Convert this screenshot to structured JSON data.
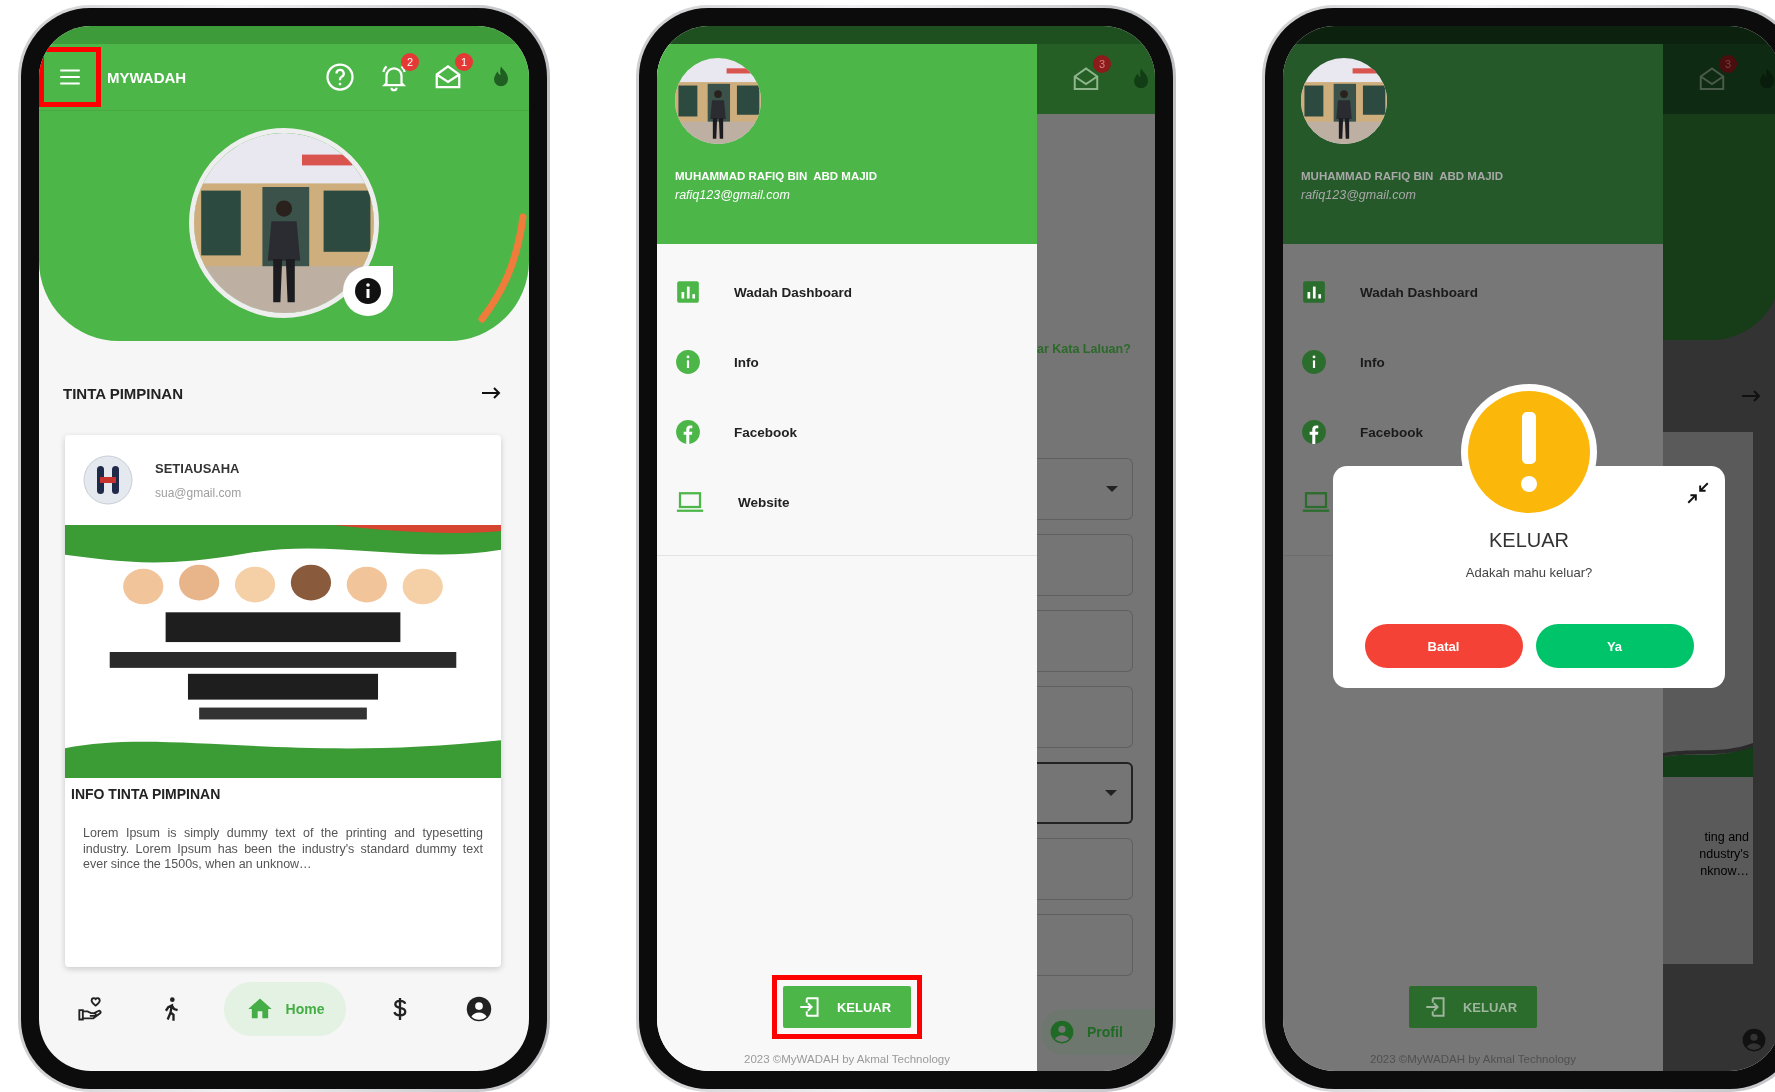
{
  "home_screen": {
    "app_bar": {
      "menu_highlighted": true,
      "title": "MYWADAH",
      "actions": [
        {
          "kind": "help"
        },
        {
          "kind": "notifications",
          "badge": "2"
        },
        {
          "kind": "mail",
          "badge": "1"
        },
        {
          "kind": "logo"
        }
      ]
    },
    "section_title": "TINTA PIMPINAN",
    "post": {
      "author": "SETIAUSAHA",
      "email": "sua@gmail.com",
      "heading": "INFO TINTA PIMPINAN",
      "body": "Lorem Ipsum is simply dummy text of the printing and typesetting industry. Lorem Ipsum has been the industry's standard dummy text ever since the 1500s, when an unknow…"
    },
    "bottom_nav": [
      {
        "kind": "charity",
        "selected": false
      },
      {
        "kind": "activity",
        "selected": false
      },
      {
        "kind": "home",
        "label": "Home",
        "selected": true
      },
      {
        "kind": "payment",
        "selected": false
      },
      {
        "kind": "profile",
        "selected": false
      }
    ]
  },
  "drawer_screen": {
    "background": {
      "mail_badge": "3",
      "link": "ar Kata Laluan?",
      "fields": [
        {
          "kind": "select",
          "focused": false
        },
        {
          "kind": "text",
          "focused": false
        },
        {
          "kind": "text",
          "focused": false
        },
        {
          "kind": "text",
          "focused": false
        },
        {
          "kind": "select",
          "focused": true
        },
        {
          "kind": "text",
          "focused": false
        },
        {
          "kind": "text",
          "focused": false
        }
      ],
      "nav_label": "Profil"
    },
    "drawer": {
      "name": "MUHAMMAD RAFIQ BIN  ABD MAJID",
      "email": "rafiq123@gmail.com",
      "items": [
        {
          "kind": "dashboard",
          "label": "Wadah Dashboard"
        },
        {
          "kind": "info",
          "label": "Info"
        },
        {
          "kind": "facebook",
          "label": "Facebook"
        },
        {
          "kind": "website",
          "label": "Website"
        }
      ],
      "logout": {
        "label": "KELUAR",
        "highlighted": true
      },
      "footer": "2023 ©MyWADAH by Akmal Technology"
    }
  },
  "dialog_screen": {
    "background": {
      "mail_badge": "3",
      "text_fragments": [
        "ting and",
        "ndustry's",
        "nknow…"
      ]
    },
    "drawer": {
      "name": "MUHAMMAD RAFIQ BIN  ABD MAJID",
      "email": "rafiq123@gmail.com",
      "items": [
        {
          "kind": "dashboard",
          "label": "Wadah Dashboard"
        },
        {
          "kind": "info",
          "label": "Info"
        },
        {
          "kind": "facebook",
          "label": "Facebook"
        },
        {
          "kind": "website"
        }
      ],
      "logout": {
        "label": "KELUAR",
        "highlighted": false
      },
      "footer": "2023 ©MyWADAH by Akmal Technology"
    },
    "dialog": {
      "title": "KELUAR",
      "message": "Adakah mahu keluar?",
      "buttons": [
        {
          "kind": "cancel",
          "label": "Batal"
        },
        {
          "kind": "confirm",
          "label": "Ya"
        }
      ]
    }
  }
}
